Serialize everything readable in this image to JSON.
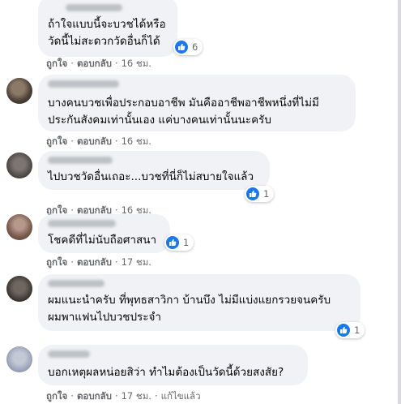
{
  "comments": [
    {
      "text_lines": [
        "ถ้าใจแบบนี้จะบวชได้หรือ",
        "วัดนี้ไม่สะดวกวัดอื่นก็ได้"
      ],
      "like_count": "6",
      "like_label": "ถูกใจ",
      "reply_label": "ตอบกลับ",
      "time": "16 ชม."
    },
    {
      "text_lines": [
        "บางคนบวชเพื่อประกอบอาชีพ มันคืออาชีพอาชีพหนึ่งที่ไม่มี",
        "ประกันสังคมเท่านั้นเอง แค่บางคนเท่านั้นนะครับ"
      ],
      "like_label": "ถูกใจ",
      "reply_label": "ตอบกลับ",
      "time": "16 ชม."
    },
    {
      "text_lines": [
        "ไปบวชวัดอื่นเถอะ...บวชที่นี่ก็ไม่สบายใจแล้ว"
      ],
      "like_count": "1",
      "like_label": "ถูกใจ",
      "reply_label": "ตอบกลับ",
      "time": "16 ชม."
    },
    {
      "text_lines": [
        "โชคดีที่ไม่นับถือศาสนา"
      ],
      "like_count": "1",
      "like_label": "ถูกใจ",
      "reply_label": "ตอบกลับ",
      "time": "17 ชม."
    },
    {
      "text_lines": [
        "ผมแนะนำครับ ที่พุทธสาวิกา บ้านบึง ไม่มีแบ่งแยกรวยจนครับ",
        "ผมพาแฟนไปบวชประจำ"
      ],
      "like_count": "1",
      "like_label": "ถูกใจ",
      "reply_label": "ตอบกลับ",
      "time": "17 ชม."
    },
    {
      "text_lines": [
        "บอกเหตุผลหน่อยสิว่า ทำไมต้องเป็นวัดนี้ด้วยสงสัย?"
      ],
      "like_label": "ถูกใจ",
      "reply_label": "ตอบกลับ",
      "time": "17 ชม.",
      "edited_label": "แก้ไขแล้ว"
    }
  ],
  "colors": {
    "bubble": "#f0f2f5",
    "meta_text": "#65676b",
    "like_blue": "#1877f2"
  },
  "icons": {
    "like": "thumbs-up-icon"
  }
}
